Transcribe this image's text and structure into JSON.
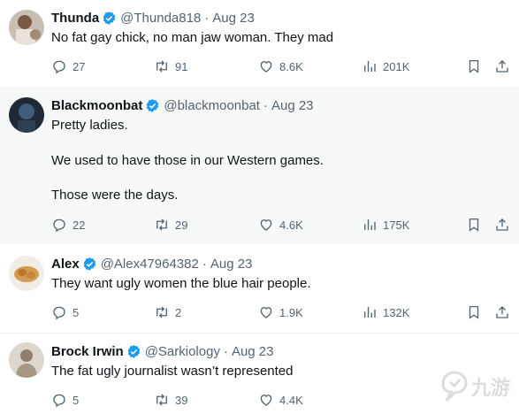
{
  "tweets": [
    {
      "name": "Thunda",
      "handle": "@Thunda818",
      "date": "Aug 23",
      "lines": [
        "No fat gay chick, no man jaw woman. They mad"
      ],
      "replies": "27",
      "retweets": "91",
      "likes": "8.6K",
      "views": "201K",
      "highlighted": false
    },
    {
      "name": "Blackmoonbat",
      "handle": "@blackmoonbat",
      "date": "Aug 23",
      "lines": [
        "Pretty ladies.",
        "We used to have those in our Western games.",
        "Those were the days."
      ],
      "replies": "22",
      "retweets": "29",
      "likes": "4.6K",
      "views": "175K",
      "highlighted": true
    },
    {
      "name": "Alex",
      "handle": "@Alex47964382",
      "date": "Aug 23",
      "lines": [
        "They want ugly women the blue hair people."
      ],
      "replies": "5",
      "retweets": "2",
      "likes": "1.9K",
      "views": "132K",
      "highlighted": false
    },
    {
      "name": "Brock Irwin",
      "handle": "@Sarkiology",
      "date": "Aug 23",
      "lines": [
        "The fat ugly journalist wasn’t represented"
      ],
      "replies": "5",
      "retweets": "39",
      "likes": "4.4K",
      "views": "",
      "highlighted": false
    }
  ],
  "separator": "·",
  "watermark": "九游",
  "colors": {
    "verified": "#1d9bf0",
    "muted": "#536471",
    "text": "#0f1419",
    "highlight_bg": "#f7f9f9"
  },
  "icons": [
    "verified-badge-icon",
    "reply-icon",
    "retweet-icon",
    "like-icon",
    "views-icon",
    "bookmark-icon",
    "share-icon"
  ]
}
